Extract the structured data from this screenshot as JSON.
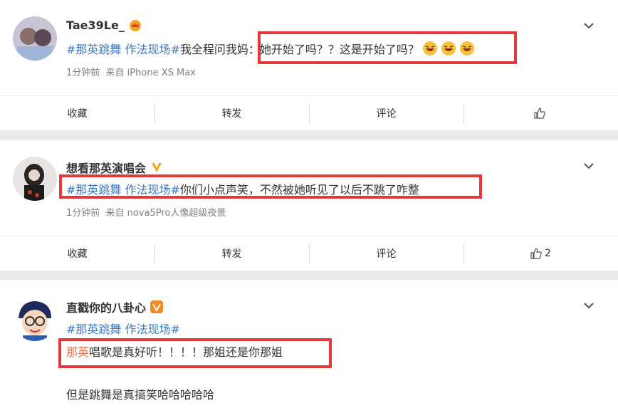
{
  "posts": [
    {
      "username": "Tae39Le_",
      "topic_tag": "#那英跳舞 作法现场#",
      "text_before_highlight": "我全程问我妈",
      "text_highlight": "：她开始了吗？？这是开始了吗？",
      "meta_time": "1分钟前",
      "meta_source": "来自 iPhone XS Max",
      "actions": {
        "collect": "收藏",
        "repost": "转发",
        "comment": "评论",
        "like_count": ""
      }
    },
    {
      "username": "想看那英演唱会",
      "topic_tag": "#那英跳舞 作法现场#",
      "text_highlight": "你们小点声笑，不然被她听见了以后不跳了咋整",
      "meta_time": "1分钟前",
      "meta_source": "来自 nova5Pro人像超级夜景",
      "actions": {
        "collect": "收藏",
        "repost": "转发",
        "comment": "评论",
        "like_count": "2"
      }
    },
    {
      "username": "直戳你的八卦心",
      "topic_tag": "#那英跳舞 作法现场#",
      "line2_mention": "那英",
      "line2_text": "唱歌是真好听！！！！那姐还是你那姐",
      "line3_text": "但是跳舞是真搞笑哈哈哈哈哈"
    }
  ],
  "colors": {
    "highlight_box": "#e4393c",
    "topic": "#3b77c6",
    "mention": "#eb7350"
  }
}
